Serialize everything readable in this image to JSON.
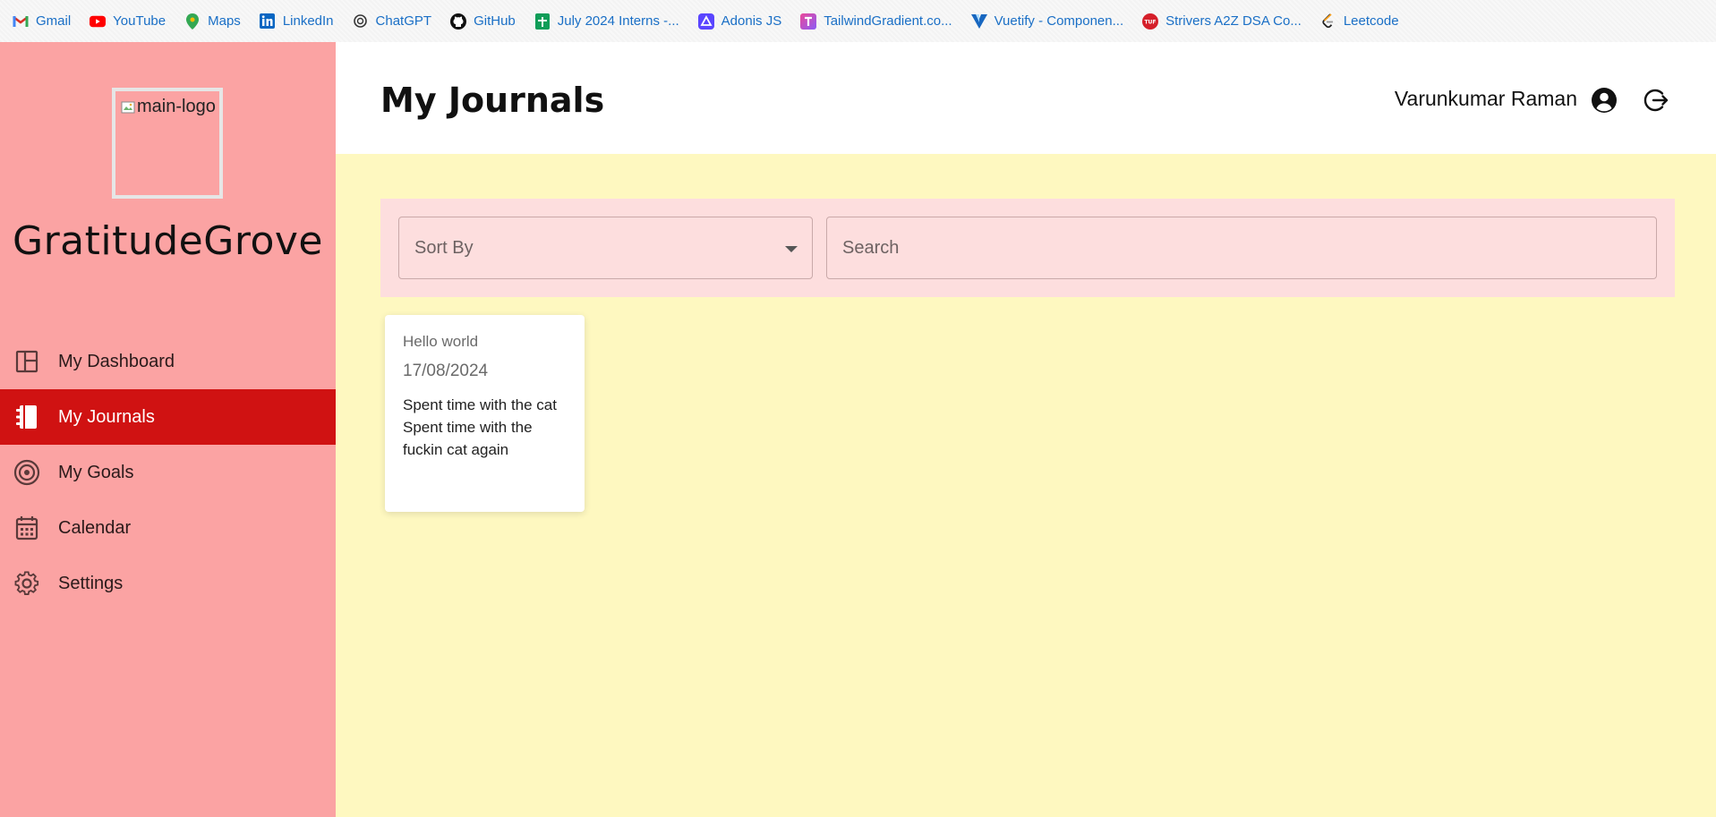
{
  "bookmarks": [
    {
      "label": "Gmail",
      "icon": "gmail-icon"
    },
    {
      "label": "YouTube",
      "icon": "youtube-icon"
    },
    {
      "label": "Maps",
      "icon": "maps-icon"
    },
    {
      "label": "LinkedIn",
      "icon": "linkedin-icon"
    },
    {
      "label": "ChatGPT",
      "icon": "chatgpt-icon"
    },
    {
      "label": "GitHub",
      "icon": "github-icon"
    },
    {
      "label": "July 2024 Interns -...",
      "icon": "sheets-icon"
    },
    {
      "label": "Adonis JS",
      "icon": "adonis-icon"
    },
    {
      "label": "TailwindGradient.co...",
      "icon": "tailwind-gradient-icon"
    },
    {
      "label": "Vuetify - Componen...",
      "icon": "vuetify-icon"
    },
    {
      "label": "Strivers A2Z DSA Co...",
      "icon": "tuf-icon"
    },
    {
      "label": "Leetcode",
      "icon": "leetcode-icon"
    }
  ],
  "sidebar": {
    "logo_alt": "main-logo",
    "brand": "GratitudeGrove",
    "items": [
      {
        "label": "My Dashboard",
        "icon": "dashboard-icon"
      },
      {
        "label": "My Journals",
        "icon": "journal-icon",
        "active": true
      },
      {
        "label": "My Goals",
        "icon": "target-icon"
      },
      {
        "label": "Calendar",
        "icon": "calendar-icon"
      },
      {
        "label": "Settings",
        "icon": "gear-icon"
      }
    ]
  },
  "header": {
    "title": "My Journals",
    "user_name": "Varunkumar Raman"
  },
  "filters": {
    "sort_label": "Sort By",
    "search_placeholder": "Search"
  },
  "journals": [
    {
      "title": "Hello world",
      "date": "17/08/2024",
      "lines": [
        "Spent time with the cat",
        "Spent time with the fuckin cat again"
      ]
    }
  ],
  "colors": {
    "sidebar_bg": "#fba3a3",
    "active_item_bg": "#d01212",
    "main_bg": "#fef8c0",
    "filter_bar_bg": "#fddede"
  }
}
